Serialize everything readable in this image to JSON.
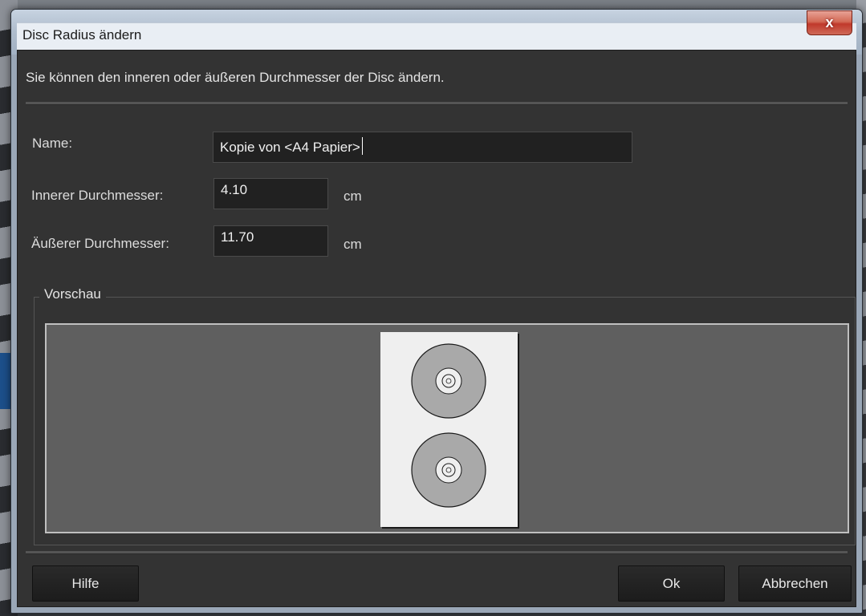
{
  "dialog": {
    "title": "Disc Radius ändern",
    "close_glyph": "x",
    "description": "Sie können den inneren oder äußeren Durchmesser der Disc ändern."
  },
  "form": {
    "name_label": "Name:",
    "name_value": "Kopie von <A4 Papier>",
    "inner_label": "Innerer Durchmesser:",
    "inner_value": "4.10",
    "inner_unit": "cm",
    "outer_label": "Äußerer Durchmesser:",
    "outer_value": "11.70",
    "outer_unit": "cm"
  },
  "preview": {
    "legend": "Vorschau",
    "disc_count": 2,
    "paper_color": "#efefef",
    "disc_color": "#a9a9a9"
  },
  "buttons": {
    "help": "Hilfe",
    "ok": "Ok",
    "cancel": "Abbrechen"
  },
  "colors": {
    "dialog_bg": "#333333",
    "field_bg": "#212121",
    "close_red": "#c0392b"
  }
}
